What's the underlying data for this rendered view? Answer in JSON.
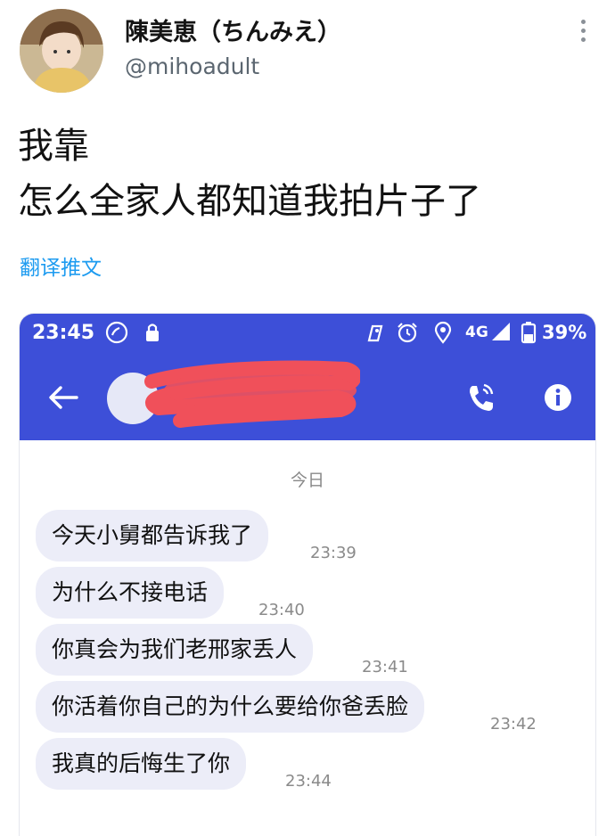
{
  "tweet": {
    "name": "陳美恵（ちんみえ）",
    "handle": "@mihoadult",
    "lines": [
      "我靠",
      "怎么全家人都知道我拍片子了"
    ],
    "translate_label": "翻译推文"
  },
  "phone": {
    "status": {
      "time": "23:45",
      "network": "4G",
      "battery": "39%"
    },
    "header": {
      "back_icon": "arrow-left-icon",
      "call_icon": "phone-call-icon",
      "info_icon": "info-icon"
    },
    "date_separator": "今日",
    "messages": [
      {
        "text": "今天小舅都告诉我了",
        "time": "23:39"
      },
      {
        "text": "为什么不接电话",
        "time": "23:40"
      },
      {
        "text": "你真会为我们老邢家丢人",
        "time": "23:41"
      },
      {
        "text": "你活着你自己的为什么要给你爸丢脸",
        "time": "23:42"
      },
      {
        "text": "我真的后悔生了你",
        "time": "23:44"
      }
    ]
  },
  "colors": {
    "accent_blue": "#3d4fd8",
    "bubble_bg": "#ecedf8",
    "translate_blue": "#1d9bf0",
    "redact_red": "#f0505a"
  }
}
